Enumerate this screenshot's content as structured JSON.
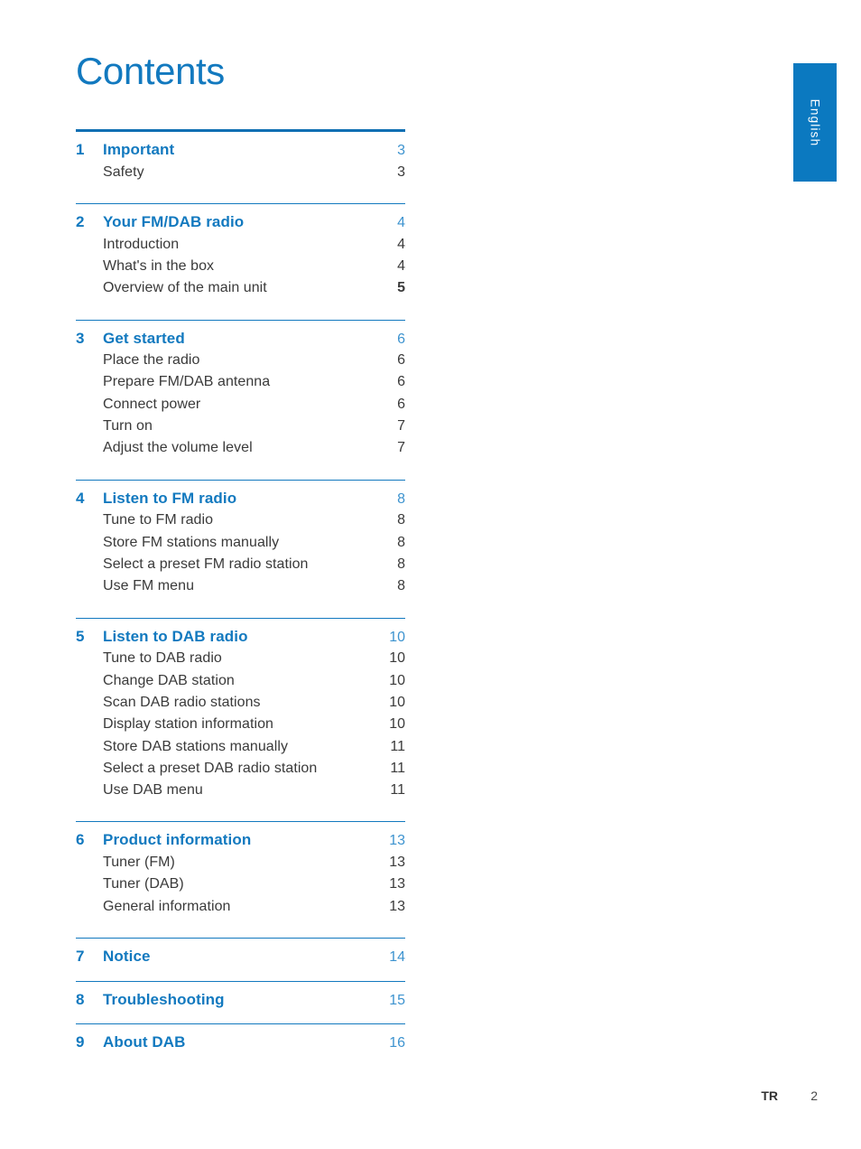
{
  "page": {
    "title": "Contents",
    "language_tab": "English",
    "footer": {
      "language_code": "TR",
      "page_number": "2"
    },
    "colors": {
      "heading_blue": "#1279bf",
      "tab_blue": "#0b79c0",
      "rule_blue": "#1279bf",
      "page_number_blue": "#3d93cf",
      "body_text": "#3a3a3a"
    }
  },
  "toc": {
    "sections": [
      {
        "number": "1",
        "title": "Important",
        "page": "3",
        "items": [
          {
            "label": "Safety",
            "page": "3"
          }
        ]
      },
      {
        "number": "2",
        "title": "Your FM/DAB radio",
        "page": "4",
        "items": [
          {
            "label": "Introduction",
            "page": "4"
          },
          {
            "label": "What's in the box",
            "page": "4"
          },
          {
            "label": "Overview of the main unit",
            "page": "5",
            "bold_page": true
          }
        ]
      },
      {
        "number": "3",
        "title": "Get started",
        "page": "6",
        "items": [
          {
            "label": "Place the radio",
            "page": "6"
          },
          {
            "label": "Prepare FM/DAB antenna",
            "page": "6"
          },
          {
            "label": "Connect power",
            "page": "6"
          },
          {
            "label": "Turn on",
            "page": "7"
          },
          {
            "label": "Adjust the volume level",
            "page": "7"
          }
        ]
      },
      {
        "number": "4",
        "title": "Listen to FM radio",
        "page": "8",
        "items": [
          {
            "label": "Tune to FM radio",
            "page": "8"
          },
          {
            "label": "Store FM stations manually",
            "page": "8"
          },
          {
            "label": "Select a preset FM radio station",
            "page": "8"
          },
          {
            "label": "Use FM menu",
            "page": "8"
          }
        ]
      },
      {
        "number": "5",
        "title": "Listen to DAB radio",
        "page": "10",
        "items": [
          {
            "label": "Tune to DAB radio",
            "page": "10"
          },
          {
            "label": "Change DAB station",
            "page": "10"
          },
          {
            "label": "Scan DAB radio stations",
            "page": "10"
          },
          {
            "label": "Display station information",
            "page": "10"
          },
          {
            "label": "Store DAB stations manually",
            "page": "11"
          },
          {
            "label": "Select a preset DAB radio station",
            "page": "11"
          },
          {
            "label": "Use DAB menu",
            "page": "11"
          }
        ]
      },
      {
        "number": "6",
        "title": "Product information",
        "page": "13",
        "items": [
          {
            "label": "Tuner (FM)",
            "page": "13"
          },
          {
            "label": "Tuner (DAB)",
            "page": "13"
          },
          {
            "label": "General information",
            "page": "13"
          }
        ]
      },
      {
        "number": "7",
        "title": "Notice",
        "page": "14",
        "items": []
      },
      {
        "number": "8",
        "title": "Troubleshooting",
        "page": "15",
        "items": []
      },
      {
        "number": "9",
        "title": "About DAB",
        "page": "16",
        "items": []
      }
    ]
  }
}
